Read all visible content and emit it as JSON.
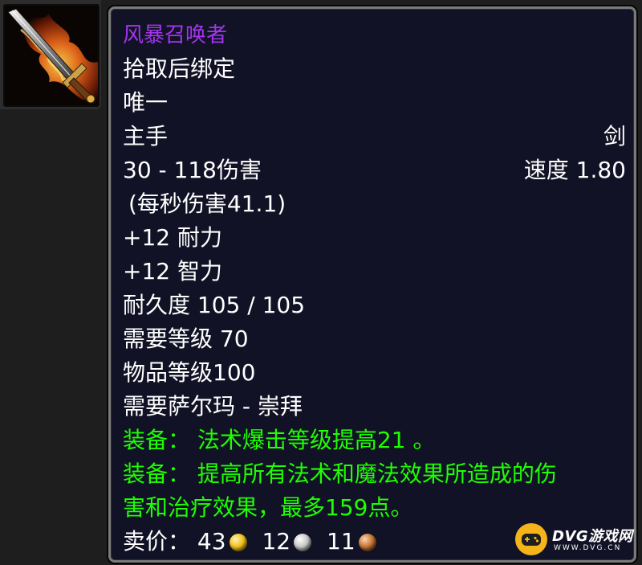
{
  "item_icon": {
    "name": "flaming-sword-icon"
  },
  "tooltip": {
    "name": "风暴召唤者",
    "bind": "拾取后绑定",
    "unique": "唯一",
    "slot": "主手",
    "weapon_type": "剑",
    "damage": "30 - 118伤害",
    "speed": "速度 1.80",
    "dps": "(每秒伤害41.1)",
    "stat_stamina": "+12 耐力",
    "stat_intellect": "+12 智力",
    "durability": "耐久度 105 / 105",
    "required_level": "需要等级 70",
    "item_level": "物品等级100",
    "required_reputation": "需要萨尔玛 - 崇拜",
    "equip_1": "装备：  法术爆击等级提高21 。",
    "equip_2_line1": "装备：  提高所有法术和魔法效果所造成的伤",
    "equip_2_line2": "害和治疗效果，最多159点。",
    "sell_label": "卖价：",
    "sell_gold": "43",
    "sell_silver": "12",
    "sell_copper": "11"
  },
  "colors": {
    "item_name": "#a335ee",
    "equip_text": "#1eff00",
    "tooltip_bg": "#121226"
  },
  "watermark": {
    "title": "DVG游戏网",
    "subtitle": "WWW.DVG.CN"
  }
}
